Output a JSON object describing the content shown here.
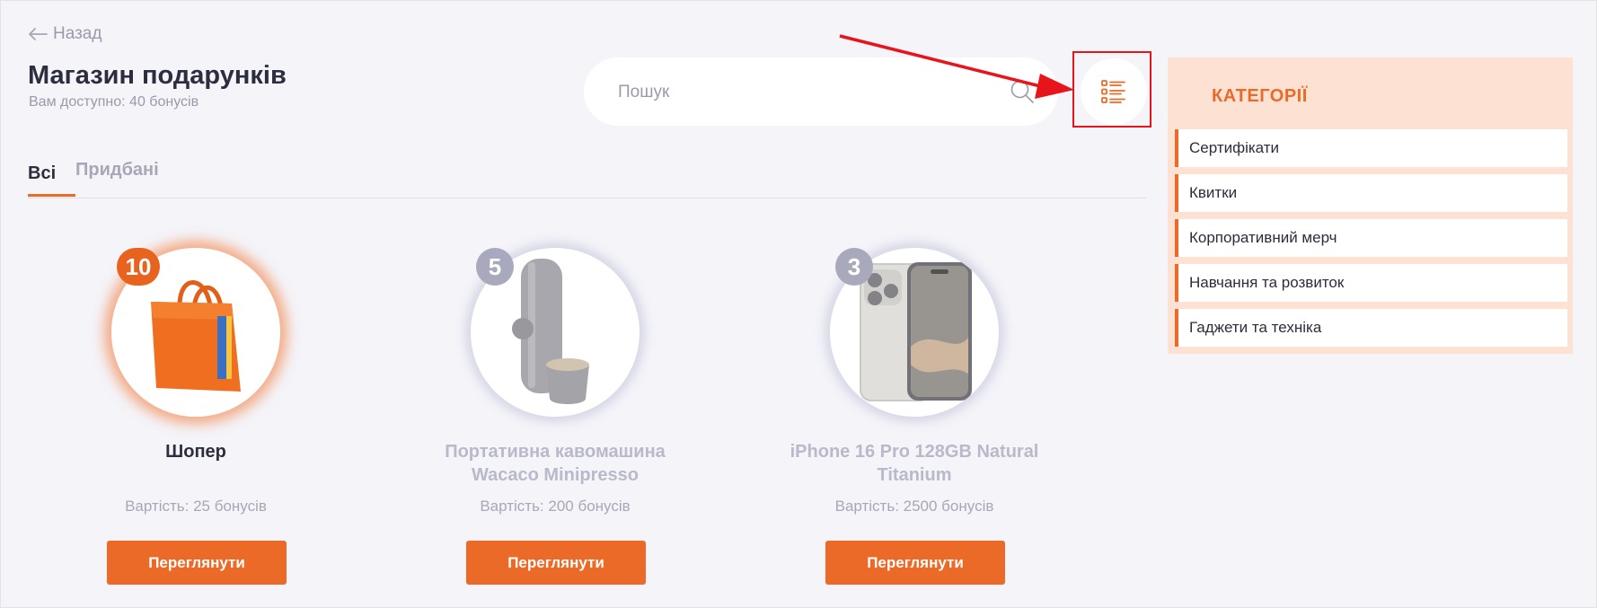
{
  "nav": {
    "back_label": "Назад"
  },
  "header": {
    "title": "Магазин подарунків",
    "balance_text": "Вам доступно: 40 бонусів"
  },
  "search": {
    "placeholder": "Пошук",
    "value": ""
  },
  "tabs": [
    {
      "label": "Всі",
      "active": true
    },
    {
      "label": "Придбані",
      "active": false
    }
  ],
  "products": [
    {
      "name": "Шопер",
      "badge": "10",
      "price": "Вартість: 25 бонусів",
      "button": "Переглянути",
      "available": true
    },
    {
      "name": "Портативна кавомашина Wacaco Minipresso",
      "badge": "5",
      "price": "Вартість: 200 бонусів",
      "button": "Переглянути",
      "available": false
    },
    {
      "name": "iPhone 16 Pro 128GB Natural Titanium",
      "badge": "3",
      "price": "Вартість: 2500 бонусів",
      "button": "Переглянути",
      "available": false
    }
  ],
  "categories": {
    "title": "КАТЕГОРІЇ",
    "items": [
      "Сертифікати",
      "Квитки",
      "Корпоративний мерч",
      "Навчання та розвиток",
      "Гаджети та техніка"
    ]
  },
  "colors": {
    "accent": "#ec6a28",
    "annotation_red": "#e8141c",
    "panel_bg": "#fde2d4",
    "page_bg": "#f4f4f9"
  },
  "icons": {
    "back": "arrow-left-icon",
    "search": "search-icon",
    "view_toggle": "list-view-icon"
  }
}
